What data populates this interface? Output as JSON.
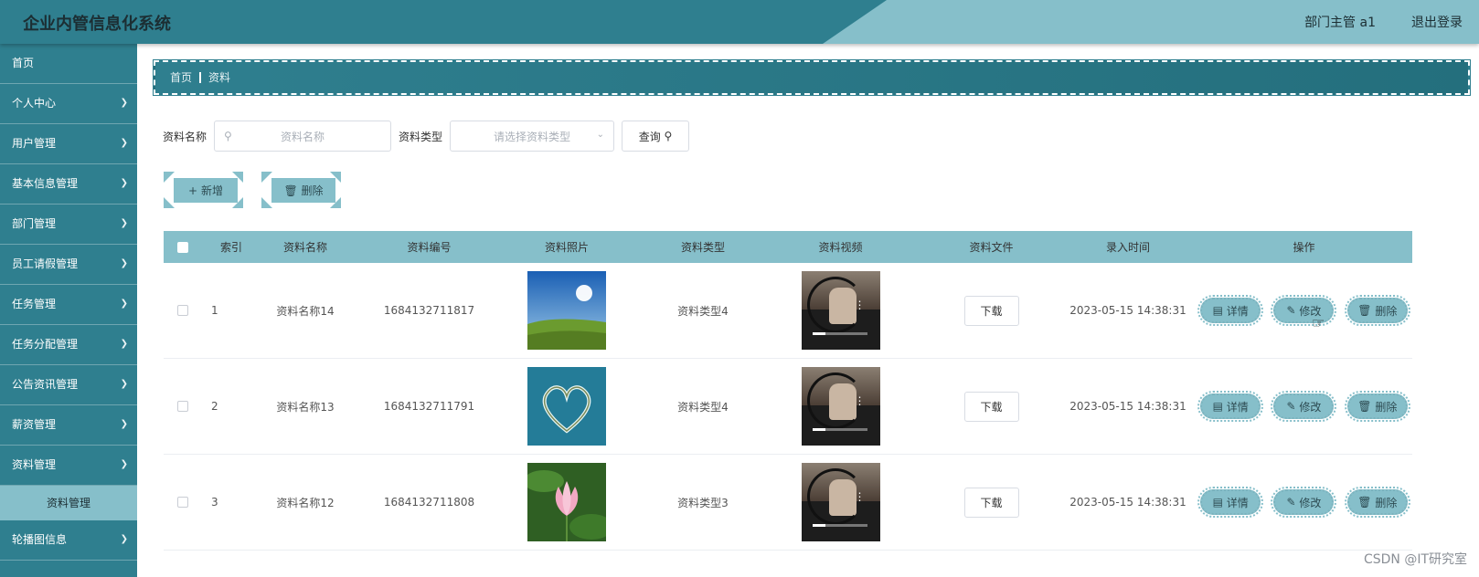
{
  "header": {
    "title": "企业内管信息化系统",
    "user": "部门主管 a1",
    "logout": "退出登录"
  },
  "sidebar": {
    "items": [
      {
        "label": "首页",
        "has_children": false
      },
      {
        "label": "个人中心",
        "has_children": true
      },
      {
        "label": "用户管理",
        "has_children": true
      },
      {
        "label": "基本信息管理",
        "has_children": true
      },
      {
        "label": "部门管理",
        "has_children": true
      },
      {
        "label": "员工请假管理",
        "has_children": true
      },
      {
        "label": "任务管理",
        "has_children": true
      },
      {
        "label": "任务分配管理",
        "has_children": true
      },
      {
        "label": "公告资讯管理",
        "has_children": true
      },
      {
        "label": "薪资管理",
        "has_children": true
      },
      {
        "label": "资料管理",
        "has_children": true,
        "expanded": true
      },
      {
        "label": "轮播图信息",
        "has_children": true
      }
    ],
    "sub_item": "资料管理",
    "chevron": "chevron-down-icon"
  },
  "breadcrumb": {
    "home": "首页",
    "current": "资料"
  },
  "search": {
    "name_label": "资料名称",
    "name_placeholder": "资料名称",
    "type_label": "资料类型",
    "type_placeholder": "请选择资料类型",
    "query_label": "查询"
  },
  "actions": {
    "add": "新增",
    "delete": "删除"
  },
  "table": {
    "columns": [
      "索引",
      "资料名称",
      "资料编号",
      "资料照片",
      "资料类型",
      "资料视频",
      "资料文件",
      "录入时间",
      "操作"
    ],
    "rows": [
      {
        "index": "1",
        "name": "资料名称14",
        "code": "1684132711817",
        "photo": "sky-field",
        "type": "资料类型4",
        "file": "下载",
        "time": "2023-05-15 14:38:31"
      },
      {
        "index": "2",
        "name": "资料名称13",
        "code": "1684132711791",
        "photo": "heart-island",
        "type": "资料类型4",
        "file": "下载",
        "time": "2023-05-15 14:38:31"
      },
      {
        "index": "3",
        "name": "资料名称12",
        "code": "1684132711808",
        "photo": "lotus",
        "type": "资料类型3",
        "file": "下载",
        "time": "2023-05-15 14:38:31"
      }
    ],
    "op_detail": "详情",
    "op_edit": "修改",
    "op_delete": "删除"
  },
  "watermark": "CSDN @IT研究室",
  "colors": {
    "primary": "#2f7f8f",
    "accent": "#86bfca"
  }
}
